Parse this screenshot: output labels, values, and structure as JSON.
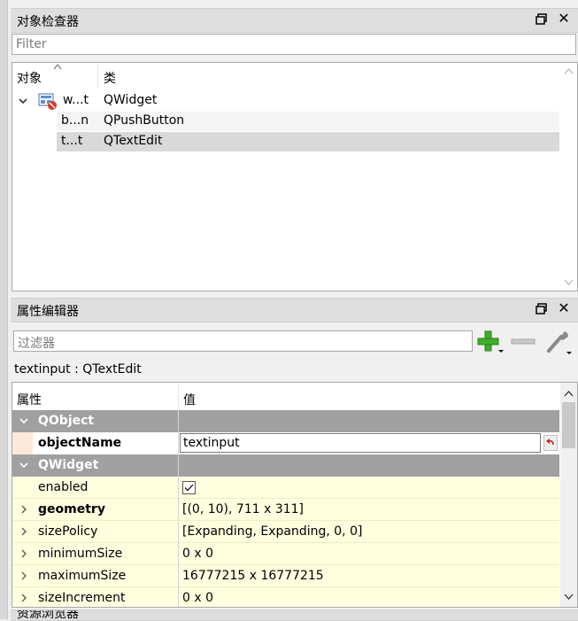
{
  "object_inspector": {
    "title": "对象检查器",
    "filter_placeholder": "Filter",
    "col_object": "对象",
    "col_class": "类",
    "rows": [
      {
        "name": "w...t",
        "class": "QWidget"
      },
      {
        "name": "b...n",
        "class": "QPushButton"
      },
      {
        "name": "t...t",
        "class": "QTextEdit"
      }
    ]
  },
  "property_editor": {
    "title": "属性编辑器",
    "filter_placeholder": "过滤器",
    "object_info": "textinput : QTextEdit",
    "col_property": "属性",
    "col_value": "值",
    "cat_qobject": "QObject",
    "cat_qwidget": "QWidget",
    "props": {
      "objectName": {
        "name": "objectName",
        "value": "textinput"
      },
      "enabled": {
        "name": "enabled",
        "checked": true
      },
      "geometry": {
        "name": "geometry",
        "value": "[(0, 10), 711 x 311]"
      },
      "sizePolicy": {
        "name": "sizePolicy",
        "value": "[Expanding, Expanding, 0, 0]"
      },
      "minimumSize": {
        "name": "minimumSize",
        "value": "0 x 0"
      },
      "maximumSize": {
        "name": "maximumSize",
        "value": "16777215 x 16777215"
      },
      "sizeIncrement": {
        "name": "sizeIncrement",
        "value": "0 x 0"
      }
    }
  },
  "resource_browser": {
    "title": "资源浏览器"
  },
  "colors": {
    "category_bg": "#a0a0a0",
    "property_bg": "#ffffe0",
    "selected_row": "#d9d9d9",
    "add_green": "#3fae2a"
  }
}
